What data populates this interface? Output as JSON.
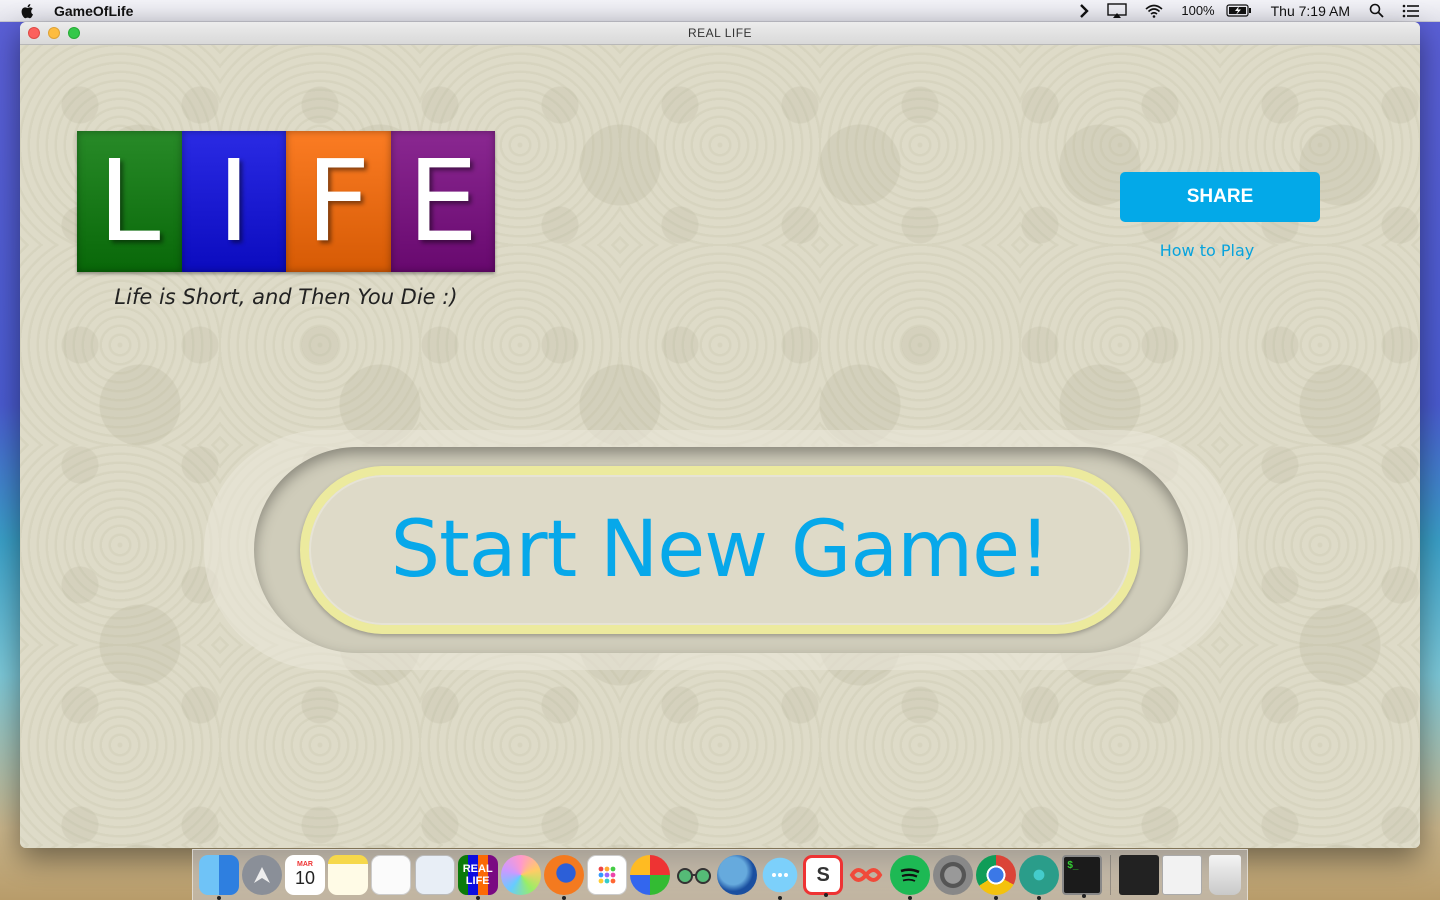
{
  "menubar": {
    "app_name": "GameOfLife",
    "battery": "100%",
    "clock": "Thu 7:19 AM"
  },
  "window": {
    "title": "REAL LIFE"
  },
  "logo": {
    "letters": [
      "L",
      "I",
      "F",
      "E"
    ],
    "colors": [
      "#0a7a0a",
      "#0d0de0",
      "#fb6a05",
      "#7a0a82"
    ],
    "tagline": "Life is Short, and Then You Die :)"
  },
  "actions": {
    "share_label": "SHARE",
    "howto_label": "How to Play",
    "start_label": "Start New Game!"
  },
  "dock": {
    "calendar_month": "MAR",
    "calendar_day": "10",
    "app_badge": [
      "REAL",
      "LIFE"
    ]
  }
}
